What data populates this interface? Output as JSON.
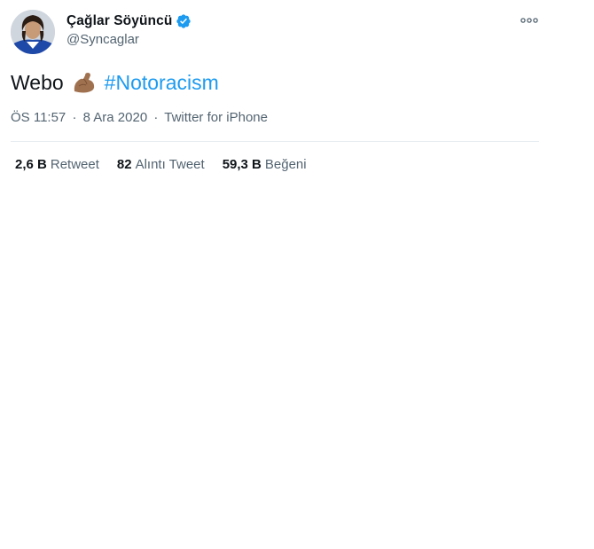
{
  "author": {
    "display_name": "Çağlar Söyüncü",
    "handle": "@Syncaglar",
    "verified": true
  },
  "more_icon": "more-horizontal-icon",
  "tweet": {
    "word": "Webo",
    "emoji": "flexed-biceps-emoji",
    "hashtag": "#Notoracism"
  },
  "meta": {
    "time": "ÖS 11:57",
    "separator": "·",
    "date": "8 Ara 2020",
    "source": "Twitter for iPhone"
  },
  "stats": [
    {
      "count": "2,6 B",
      "label": "Retweet"
    },
    {
      "count": "82",
      "label": "Alıntı Tweet"
    },
    {
      "count": "59,3 B",
      "label": "Beğeni"
    }
  ],
  "colors": {
    "accent": "#1d9bf0",
    "secondary_text": "#536471",
    "primary_text": "#0f1419"
  }
}
